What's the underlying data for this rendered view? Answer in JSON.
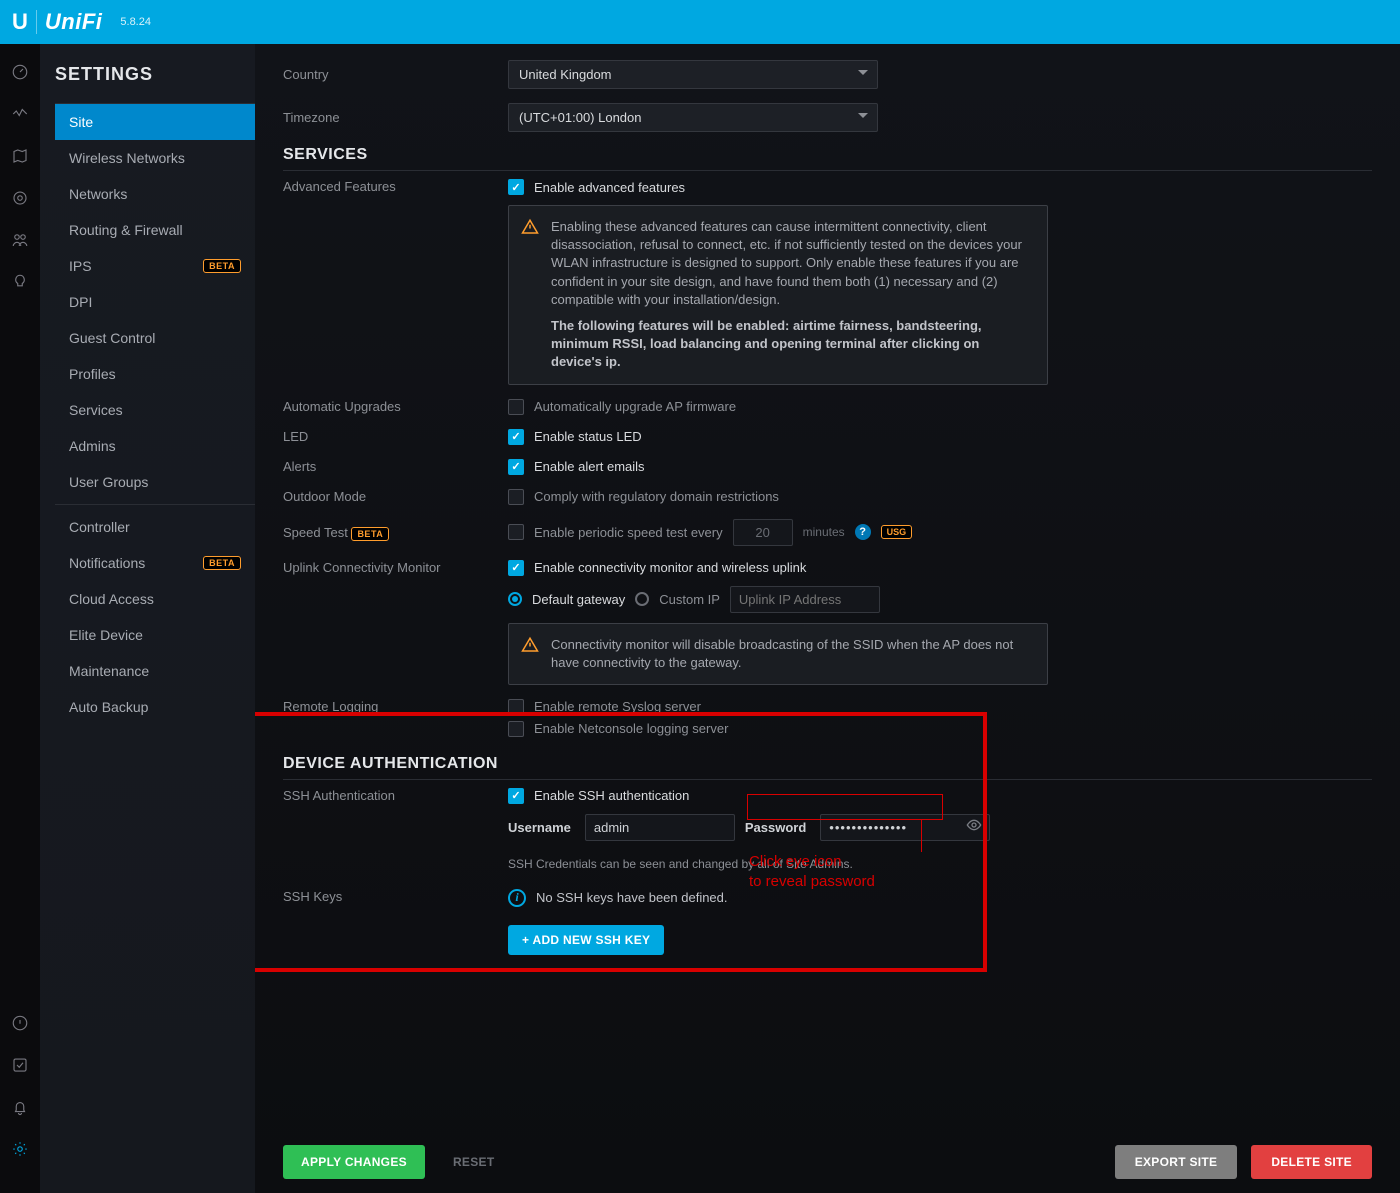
{
  "topbar": {
    "brand": "UniFi",
    "version": "5.8.24"
  },
  "sidebar": {
    "title": "SETTINGS",
    "group1": [
      {
        "label": "Site",
        "active": true
      },
      {
        "label": "Wireless Networks"
      },
      {
        "label": "Networks"
      },
      {
        "label": "Routing & Firewall"
      },
      {
        "label": "IPS",
        "beta": true
      },
      {
        "label": "DPI"
      },
      {
        "label": "Guest Control"
      },
      {
        "label": "Profiles"
      },
      {
        "label": "Services"
      },
      {
        "label": "Admins"
      },
      {
        "label": "User Groups"
      }
    ],
    "group2": [
      {
        "label": "Controller"
      },
      {
        "label": "Notifications",
        "beta": true
      },
      {
        "label": "Cloud Access"
      },
      {
        "label": "Elite Device"
      },
      {
        "label": "Maintenance"
      },
      {
        "label": "Auto Backup"
      }
    ],
    "beta_label": "BETA"
  },
  "form": {
    "country_label": "Country",
    "country_value": "United Kingdom",
    "tz_label": "Timezone",
    "tz_value": "(UTC+01:00) London",
    "services_heading": "SERVICES",
    "adv_label": "Advanced Features",
    "adv_check": "Enable advanced features",
    "adv_warn1": "Enabling these advanced features can cause intermittent connectivity, client disassociation, refusal to connect, etc. if not sufficiently tested on the devices your WLAN infrastructure is designed to support. Only enable these features if you are confident in your site design, and have found them both (1) necessary and (2) compatible with your installation/design.",
    "adv_warn2": "The following features will be enabled: airtime fairness, bandsteering, minimum RSSI, load balancing and opening terminal after clicking on device's ip.",
    "auto_upg_label": "Automatic Upgrades",
    "auto_upg_check": "Automatically upgrade AP firmware",
    "led_label": "LED",
    "led_check": "Enable status LED",
    "alerts_label": "Alerts",
    "alerts_check": "Enable alert emails",
    "outdoor_label": "Outdoor Mode",
    "outdoor_check": "Comply with regulatory domain restrictions",
    "speed_label": "Speed Test",
    "speed_check": "Enable periodic speed test every",
    "speed_value": "20",
    "speed_unit": "minutes",
    "usg_tag": "USG",
    "uplink_label": "Uplink Connectivity Monitor",
    "uplink_check": "Enable connectivity monitor and wireless uplink",
    "uplink_r1": "Default gateway",
    "uplink_r2": "Custom IP",
    "uplink_ip_ph": "Uplink IP Address",
    "uplink_warn": "Connectivity monitor will disable broadcasting of the SSID when the AP does not have connectivity to the gateway.",
    "remote_label": "Remote Logging",
    "remote_c1": "Enable remote Syslog server",
    "remote_c2": "Enable Netconsole logging server",
    "devauth_heading": "DEVICE AUTHENTICATION",
    "ssh_label": "SSH Authentication",
    "ssh_check": "Enable SSH authentication",
    "ssh_user_label": "Username",
    "ssh_user_value": "admin",
    "ssh_pass_label": "Password",
    "ssh_pass_value": "••••••••••••••",
    "ssh_hint": "SSH Credentials can be seen and changed by all of Site Admins.",
    "sshkeys_label": "SSH Keys",
    "sshkeys_empty": "No SSH keys have been defined.",
    "sshkeys_add": "+  ADD NEW SSH KEY"
  },
  "footer": {
    "apply": "APPLY CHANGES",
    "reset": "RESET",
    "export": "EXPORT SITE",
    "delete": "DELETE SITE"
  },
  "annotation": {
    "line1": "Click eye icon",
    "line2": "to reveal password"
  }
}
